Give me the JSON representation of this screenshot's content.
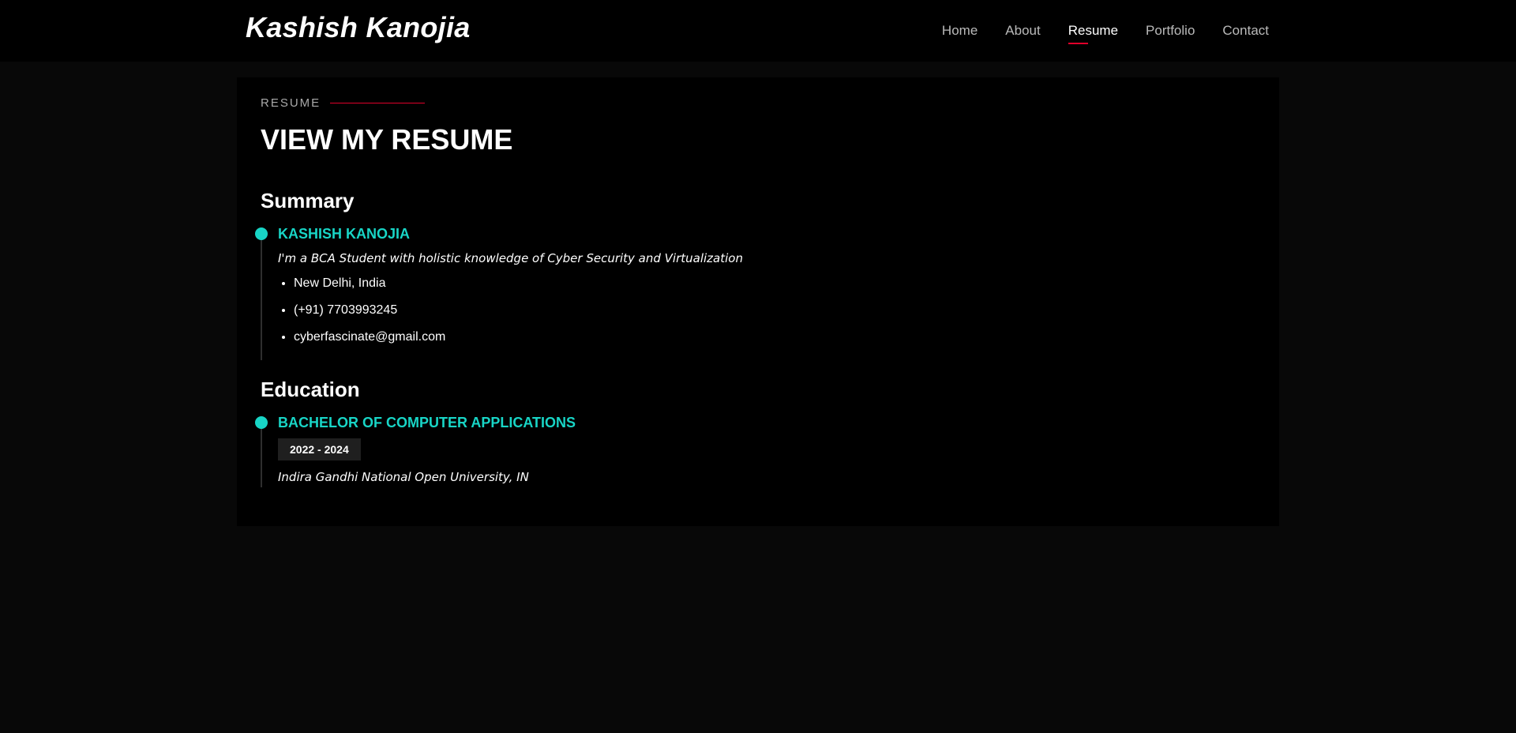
{
  "header": {
    "logo": "Kashish Kanojia",
    "nav": [
      {
        "label": "Home",
        "active": false
      },
      {
        "label": "About",
        "active": false
      },
      {
        "label": "Resume",
        "active": true
      },
      {
        "label": "Portfolio",
        "active": false
      },
      {
        "label": "Contact",
        "active": false
      }
    ]
  },
  "resume": {
    "section_label": "RESUME",
    "title": "VIEW MY RESUME",
    "summary": {
      "heading": "Summary",
      "name": "KASHISH KANOJIA",
      "description": "I'm a BCA Student with holistic knowledge of Cyber Security and Virtualization",
      "details": [
        "New Delhi, India",
        "(+91) 7703993245",
        "cyberfascinate@gmail.com"
      ]
    },
    "education": {
      "heading": "Education",
      "degree": "BACHELOR OF COMPUTER APPLICATIONS",
      "years": "2022 - 2024",
      "institution": "Indira Gandhi National Open University, IN"
    }
  },
  "colors": {
    "accent_teal": "#18d5c6",
    "accent_red": "#e0002a",
    "background": "#080808",
    "card": "#000000"
  }
}
